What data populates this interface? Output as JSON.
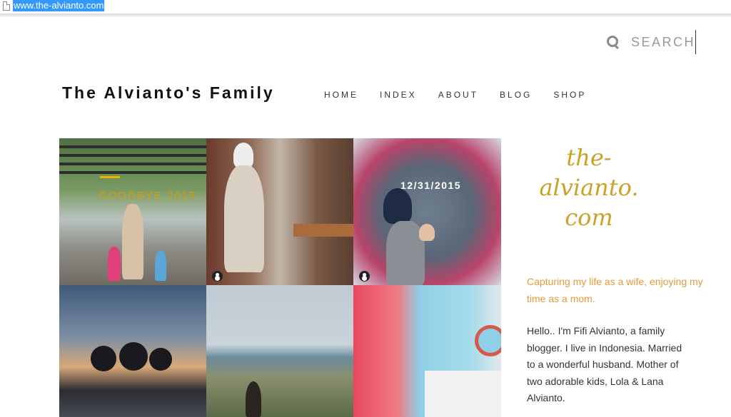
{
  "browser": {
    "url": "www.the-alvianto.com"
  },
  "header": {
    "search_label": "SEARCH",
    "site_title": "The Alvianto's Family",
    "nav": [
      "HOME",
      "INDEX",
      "ABOUT",
      "BLOG",
      "SHOP"
    ]
  },
  "grid": {
    "tiles": [
      {
        "title": "GOODBYE 2015",
        "scene": "vine-covered bridge, mother with two daughters"
      },
      {
        "title": "",
        "scene": "woman in hijab and cape by brick shelves"
      },
      {
        "title": "12/31/2015",
        "scene": "mother holding baby in front of flower wall"
      },
      {
        "title": "",
        "scene": "sunset silhouettes in infinity pool"
      },
      {
        "title": "",
        "scene": "beach with rocks and child"
      },
      {
        "title": "",
        "scene": "pastel kids room with pink curtains"
      }
    ]
  },
  "sidebar": {
    "logo_lines": [
      "the-",
      "alvianto.",
      "com"
    ],
    "tagline": "Capturing my life as a wife, enjoying my time as a mom.",
    "bio": "Hello.. I'm Fifi Alvianto, a family blogger. I live in Indonesia. Married to a wonderful husband. Mother of two adorable kids, Lola & Lana Alvianto."
  },
  "colors": {
    "accent_gold": "#c9a227",
    "tagline_orange": "#e39a3a",
    "selection_blue": "#3399ff"
  }
}
